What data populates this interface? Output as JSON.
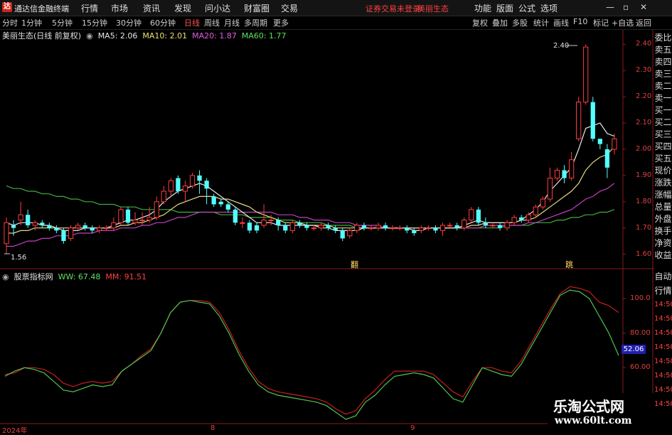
{
  "topbar": {
    "app_name": "通达信金融终端",
    "menus": [
      "行情",
      "市场",
      "资讯",
      "发现",
      "问小达",
      "财富圈",
      "交易"
    ],
    "account_text": "证券交易未登录",
    "stock_name_top": "美丽生态",
    "right_menus": [
      "功能",
      "版面",
      "公式",
      "选项"
    ],
    "win_buttons": [
      "—",
      "▫",
      "✕"
    ]
  },
  "periodbar": {
    "periods": [
      "分时",
      "1分钟",
      "5分钟",
      "15分钟",
      "30分钟",
      "60分钟",
      "日线",
      "周线",
      "月线",
      "多周期",
      "更多"
    ],
    "active_period": "日线",
    "tools": [
      "复权",
      "叠加",
      "多股",
      "统计",
      "画线",
      "F10",
      "标记",
      "+自选",
      "返回"
    ]
  },
  "main_chart": {
    "title": "美丽生态(日线 前复权)",
    "ma_labels": [
      "MA5: 2.06",
      "MA10: 2.01",
      "MA20: 1.87",
      "MA60: 1.77"
    ],
    "y_ticks": [
      "2.40",
      "2.30",
      "2.20",
      "2.10",
      "2.00",
      "1.90",
      "1.80",
      "1.70",
      "1.60"
    ],
    "high_label": "2.40",
    "low_label": "1.56",
    "marker_a": "翻",
    "marker_b": "跳"
  },
  "sub_chart": {
    "title": "股票指标网",
    "ww_label": "WW: 67.48",
    "mm_label": "MM: 91.51",
    "y_ticks": [
      "100.0",
      "80.00",
      "60.00",
      "40.00"
    ],
    "badge": "52.06"
  },
  "x_axis": {
    "labels": [
      "2024年",
      "8",
      "9"
    ]
  },
  "right_panel": {
    "items": [
      "委比",
      "卖五",
      "卖四",
      "卖三",
      "卖二",
      "卖一",
      "买一",
      "买二",
      "买三",
      "买四",
      "买五",
      "现价",
      "涨跌",
      "涨幅",
      "总量",
      "外盘",
      "换手",
      "净资",
      "收益"
    ],
    "items2": [
      "自动",
      "行情",
      "14:50",
      "14:50",
      "14:50",
      "14:50",
      "14:50",
      "14:50",
      "14:50",
      "14:50"
    ]
  },
  "watermark": {
    "title": "乐淘公式网",
    "url": "www.60lt.com"
  },
  "chart_data": {
    "type": "candlestick",
    "ylim": [
      1.55,
      2.45
    ],
    "candles": [
      [
        1.64,
        1.72,
        1.6,
        1.74
      ],
      [
        1.71,
        1.7,
        1.67,
        1.73
      ],
      [
        1.73,
        1.75,
        1.71,
        1.8
      ],
      [
        1.75,
        1.71,
        1.7,
        1.77
      ],
      [
        1.71,
        1.72,
        1.69,
        1.73
      ],
      [
        1.72,
        1.71,
        1.7,
        1.73
      ],
      [
        1.71,
        1.7,
        1.69,
        1.72
      ],
      [
        1.7,
        1.69,
        1.68,
        1.71
      ],
      [
        1.69,
        1.65,
        1.64,
        1.7
      ],
      [
        1.66,
        1.7,
        1.65,
        1.71
      ],
      [
        1.7,
        1.71,
        1.69,
        1.72
      ],
      [
        1.71,
        1.7,
        1.69,
        1.72
      ],
      [
        1.7,
        1.69,
        1.68,
        1.71
      ],
      [
        1.69,
        1.7,
        1.68,
        1.71
      ],
      [
        1.7,
        1.7,
        1.69,
        1.71
      ],
      [
        1.7,
        1.72,
        1.69,
        1.74
      ],
      [
        1.72,
        1.77,
        1.71,
        1.78
      ],
      [
        1.77,
        1.72,
        1.71,
        1.78
      ],
      [
        1.72,
        1.73,
        1.71,
        1.76
      ],
      [
        1.73,
        1.73,
        1.71,
        1.76
      ],
      [
        1.73,
        1.74,
        1.72,
        1.78
      ],
      [
        1.74,
        1.8,
        1.73,
        1.82
      ],
      [
        1.8,
        1.84,
        1.79,
        1.86
      ],
      [
        1.84,
        1.88,
        1.82,
        1.89
      ],
      [
        1.89,
        1.84,
        1.83,
        1.9
      ],
      [
        1.84,
        1.86,
        1.8,
        1.88
      ],
      [
        1.86,
        1.9,
        1.85,
        1.91
      ],
      [
        1.9,
        1.88,
        1.83,
        1.92
      ],
      [
        1.88,
        1.85,
        1.79,
        1.89
      ],
      [
        1.82,
        1.79,
        1.78,
        1.83
      ],
      [
        1.8,
        1.79,
        1.78,
        1.81
      ],
      [
        1.79,
        1.77,
        1.76,
        1.8
      ],
      [
        1.77,
        1.72,
        1.71,
        1.78
      ],
      [
        1.72,
        1.72,
        1.7,
        1.74
      ],
      [
        1.72,
        1.69,
        1.68,
        1.73
      ],
      [
        1.71,
        1.69,
        1.68,
        1.72
      ],
      [
        1.71,
        1.73,
        1.7,
        1.79
      ],
      [
        1.73,
        1.73,
        1.71,
        1.75
      ],
      [
        1.73,
        1.71,
        1.69,
        1.74
      ],
      [
        1.71,
        1.69,
        1.68,
        1.72
      ],
      [
        1.69,
        1.72,
        1.68,
        1.73
      ],
      [
        1.72,
        1.71,
        1.7,
        1.73
      ],
      [
        1.71,
        1.7,
        1.69,
        1.72
      ],
      [
        1.7,
        1.7,
        1.69,
        1.71
      ],
      [
        1.7,
        1.71,
        1.69,
        1.72
      ],
      [
        1.71,
        1.7,
        1.69,
        1.72
      ],
      [
        1.7,
        1.69,
        1.68,
        1.71
      ],
      [
        1.69,
        1.66,
        1.65,
        1.7
      ],
      [
        1.67,
        1.69,
        1.66,
        1.7
      ],
      [
        1.69,
        1.71,
        1.68,
        1.72
      ],
      [
        1.71,
        1.7,
        1.69,
        1.72
      ],
      [
        1.7,
        1.7,
        1.69,
        1.71
      ],
      [
        1.7,
        1.71,
        1.69,
        1.72
      ],
      [
        1.71,
        1.7,
        1.69,
        1.72
      ],
      [
        1.7,
        1.7,
        1.69,
        1.71
      ],
      [
        1.7,
        1.7,
        1.69,
        1.71
      ],
      [
        1.7,
        1.69,
        1.68,
        1.71
      ],
      [
        1.69,
        1.68,
        1.67,
        1.7
      ],
      [
        1.69,
        1.7,
        1.68,
        1.71
      ],
      [
        1.7,
        1.7,
        1.69,
        1.71
      ],
      [
        1.7,
        1.69,
        1.68,
        1.71
      ],
      [
        1.69,
        1.71,
        1.67,
        1.72
      ],
      [
        1.71,
        1.71,
        1.7,
        1.72
      ],
      [
        1.71,
        1.7,
        1.69,
        1.72
      ],
      [
        1.7,
        1.73,
        1.69,
        1.74
      ],
      [
        1.73,
        1.77,
        1.72,
        1.78
      ],
      [
        1.77,
        1.72,
        1.71,
        1.78
      ],
      [
        1.72,
        1.71,
        1.7,
        1.74
      ],
      [
        1.71,
        1.71,
        1.7,
        1.72
      ],
      [
        1.71,
        1.7,
        1.69,
        1.72
      ],
      [
        1.7,
        1.72,
        1.69,
        1.73
      ],
      [
        1.72,
        1.74,
        1.71,
        1.75
      ],
      [
        1.74,
        1.73,
        1.72,
        1.75
      ],
      [
        1.73,
        1.75,
        1.72,
        1.76
      ],
      [
        1.75,
        1.78,
        1.74,
        1.79
      ],
      [
        1.78,
        1.81,
        1.77,
        1.82
      ],
      [
        1.81,
        1.89,
        1.8,
        1.93
      ],
      [
        1.89,
        1.92,
        1.88,
        1.93
      ],
      [
        1.92,
        1.89,
        1.87,
        1.94
      ],
      [
        1.89,
        1.96,
        1.88,
        1.99
      ],
      [
        2.04,
        2.18,
        2.03,
        2.2
      ],
      [
        2.18,
        2.39,
        2.17,
        2.4
      ],
      [
        2.18,
        2.04,
        2.03,
        2.2
      ],
      [
        2.04,
        2.02,
        2.0,
        2.03
      ],
      [
        2.0,
        1.93,
        1.89,
        2.02
      ],
      [
        2.0,
        2.04,
        1.98,
        2.06
      ]
    ],
    "ma5": [
      1.72,
      1.71,
      1.72,
      1.72,
      1.72,
      1.71,
      1.71,
      1.7,
      1.69,
      1.69,
      1.69,
      1.7,
      1.7,
      1.7,
      1.7,
      1.71,
      1.72,
      1.73,
      1.73,
      1.74,
      1.75,
      1.77,
      1.8,
      1.82,
      1.84,
      1.85,
      1.86,
      1.87,
      1.86,
      1.84,
      1.82,
      1.8,
      1.78,
      1.76,
      1.74,
      1.72,
      1.72,
      1.72,
      1.71,
      1.71,
      1.71,
      1.71,
      1.71,
      1.71,
      1.7,
      1.7,
      1.69,
      1.69,
      1.69,
      1.69,
      1.7,
      1.7,
      1.7,
      1.7,
      1.7,
      1.7,
      1.7,
      1.69,
      1.69,
      1.7,
      1.7,
      1.7,
      1.7,
      1.7,
      1.71,
      1.72,
      1.73,
      1.72,
      1.72,
      1.72,
      1.72,
      1.72,
      1.73,
      1.75,
      1.77,
      1.8,
      1.84,
      1.87,
      1.9,
      1.93,
      2.0,
      2.08,
      2.09,
      2.1,
      2.06,
      2.05
    ],
    "ma10": [
      1.68,
      1.68,
      1.69,
      1.69,
      1.7,
      1.7,
      1.7,
      1.7,
      1.7,
      1.7,
      1.7,
      1.7,
      1.7,
      1.7,
      1.7,
      1.7,
      1.71,
      1.71,
      1.72,
      1.72,
      1.73,
      1.74,
      1.75,
      1.77,
      1.79,
      1.8,
      1.81,
      1.82,
      1.82,
      1.82,
      1.81,
      1.81,
      1.8,
      1.79,
      1.78,
      1.76,
      1.75,
      1.74,
      1.73,
      1.72,
      1.72,
      1.72,
      1.71,
      1.71,
      1.71,
      1.71,
      1.7,
      1.7,
      1.7,
      1.7,
      1.7,
      1.7,
      1.7,
      1.7,
      1.7,
      1.7,
      1.7,
      1.7,
      1.7,
      1.7,
      1.7,
      1.7,
      1.7,
      1.7,
      1.7,
      1.71,
      1.71,
      1.72,
      1.72,
      1.72,
      1.72,
      1.72,
      1.73,
      1.73,
      1.74,
      1.76,
      1.78,
      1.8,
      1.82,
      1.84,
      1.87,
      1.92,
      1.95,
      1.97,
      1.98,
      2.01
    ],
    "ma20": [
      1.63,
      1.63,
      1.64,
      1.65,
      1.65,
      1.66,
      1.66,
      1.67,
      1.67,
      1.67,
      1.68,
      1.68,
      1.68,
      1.69,
      1.69,
      1.69,
      1.7,
      1.7,
      1.7,
      1.71,
      1.71,
      1.72,
      1.72,
      1.73,
      1.74,
      1.74,
      1.75,
      1.76,
      1.76,
      1.76,
      1.76,
      1.76,
      1.76,
      1.76,
      1.76,
      1.76,
      1.76,
      1.76,
      1.75,
      1.75,
      1.75,
      1.74,
      1.74,
      1.73,
      1.73,
      1.73,
      1.72,
      1.72,
      1.72,
      1.71,
      1.71,
      1.71,
      1.71,
      1.7,
      1.7,
      1.7,
      1.7,
      1.7,
      1.7,
      1.7,
      1.7,
      1.7,
      1.7,
      1.7,
      1.7,
      1.7,
      1.7,
      1.71,
      1.71,
      1.71,
      1.71,
      1.71,
      1.71,
      1.72,
      1.72,
      1.73,
      1.74,
      1.75,
      1.76,
      1.77,
      1.79,
      1.81,
      1.82,
      1.84,
      1.85,
      1.87
    ],
    "ma60": [
      1.86,
      1.85,
      1.85,
      1.84,
      1.84,
      1.83,
      1.83,
      1.82,
      1.82,
      1.81,
      1.81,
      1.8,
      1.8,
      1.79,
      1.79,
      1.79,
      1.78,
      1.78,
      1.78,
      1.77,
      1.77,
      1.77,
      1.77,
      1.77,
      1.76,
      1.76,
      1.76,
      1.76,
      1.76,
      1.76,
      1.75,
      1.75,
      1.75,
      1.75,
      1.74,
      1.74,
      1.74,
      1.74,
      1.73,
      1.73,
      1.73,
      1.72,
      1.72,
      1.72,
      1.72,
      1.71,
      1.71,
      1.71,
      1.71,
      1.7,
      1.7,
      1.7,
      1.7,
      1.7,
      1.7,
      1.7,
      1.7,
      1.7,
      1.7,
      1.7,
      1.7,
      1.7,
      1.7,
      1.7,
      1.7,
      1.7,
      1.7,
      1.7,
      1.7,
      1.7,
      1.71,
      1.71,
      1.71,
      1.71,
      1.72,
      1.72,
      1.72,
      1.73,
      1.73,
      1.74,
      1.74,
      1.75,
      1.75,
      1.76,
      1.76,
      1.77
    ],
    "sub_ylim": [
      30,
      110
    ],
    "ww": [
      55,
      58,
      60,
      59,
      57,
      52,
      47,
      46,
      48,
      50,
      49,
      50,
      58,
      62,
      66,
      70,
      80,
      92,
      98,
      99,
      98,
      97,
      90,
      80,
      68,
      58,
      50,
      46,
      44,
      43,
      42,
      41,
      40,
      38,
      34,
      30,
      32,
      40,
      44,
      50,
      55,
      56,
      57,
      56,
      54,
      48,
      42,
      40,
      50,
      60,
      58,
      56,
      55,
      62,
      72,
      82,
      92,
      102,
      105,
      104,
      100,
      90,
      80,
      67
    ],
    "mm": [
      56,
      57,
      60,
      60,
      59,
      56,
      51,
      49,
      51,
      52,
      51,
      52,
      58,
      62,
      67,
      71,
      80,
      92,
      98,
      99,
      99,
      98,
      92,
      82,
      70,
      60,
      52,
      48,
      46,
      45,
      44,
      43,
      42,
      40,
      36,
      33,
      35,
      42,
      47,
      53,
      58,
      58,
      58,
      58,
      56,
      51,
      46,
      43,
      52,
      60,
      60,
      58,
      57,
      64,
      74,
      84,
      94,
      103,
      107,
      106,
      104,
      98,
      96,
      92
    ]
  }
}
